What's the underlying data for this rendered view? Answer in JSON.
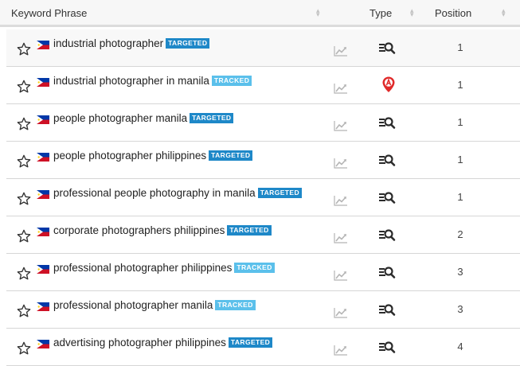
{
  "header": {
    "keyword_label": "Keyword Phrase",
    "type_label": "Type",
    "position_label": "Position"
  },
  "colors": {
    "targeted": "#1e88c8",
    "tracked": "#5bc0eb",
    "map_pin": "#e02a2a"
  },
  "rows": [
    {
      "keyword": "industrial photographer",
      "badge": "TARGETED",
      "type_icon": "organic-search-icon",
      "position": "1"
    },
    {
      "keyword": "industrial photographer in manila",
      "badge": "TRACKED",
      "type_icon": "map-pin-icon",
      "position": "1"
    },
    {
      "keyword": "people photographer manila",
      "badge": "TARGETED",
      "type_icon": "organic-search-icon",
      "position": "1"
    },
    {
      "keyword": "people photographer philippines",
      "badge": "TARGETED",
      "type_icon": "organic-search-icon",
      "position": "1"
    },
    {
      "keyword": "professional people photography in manila",
      "badge": "TARGETED",
      "type_icon": "organic-search-icon",
      "position": "1"
    },
    {
      "keyword": "corporate photographers philippines",
      "badge": "TARGETED",
      "type_icon": "organic-search-icon",
      "position": "2"
    },
    {
      "keyword": "professional photographer philippines",
      "badge": "TRACKED",
      "type_icon": "organic-search-icon",
      "position": "3"
    },
    {
      "keyword": "professional photographer manila",
      "badge": "TRACKED",
      "type_icon": "organic-search-icon",
      "position": "3"
    },
    {
      "keyword": "advertising photographer philippines",
      "badge": "TARGETED",
      "type_icon": "organic-search-icon",
      "position": "4"
    }
  ]
}
